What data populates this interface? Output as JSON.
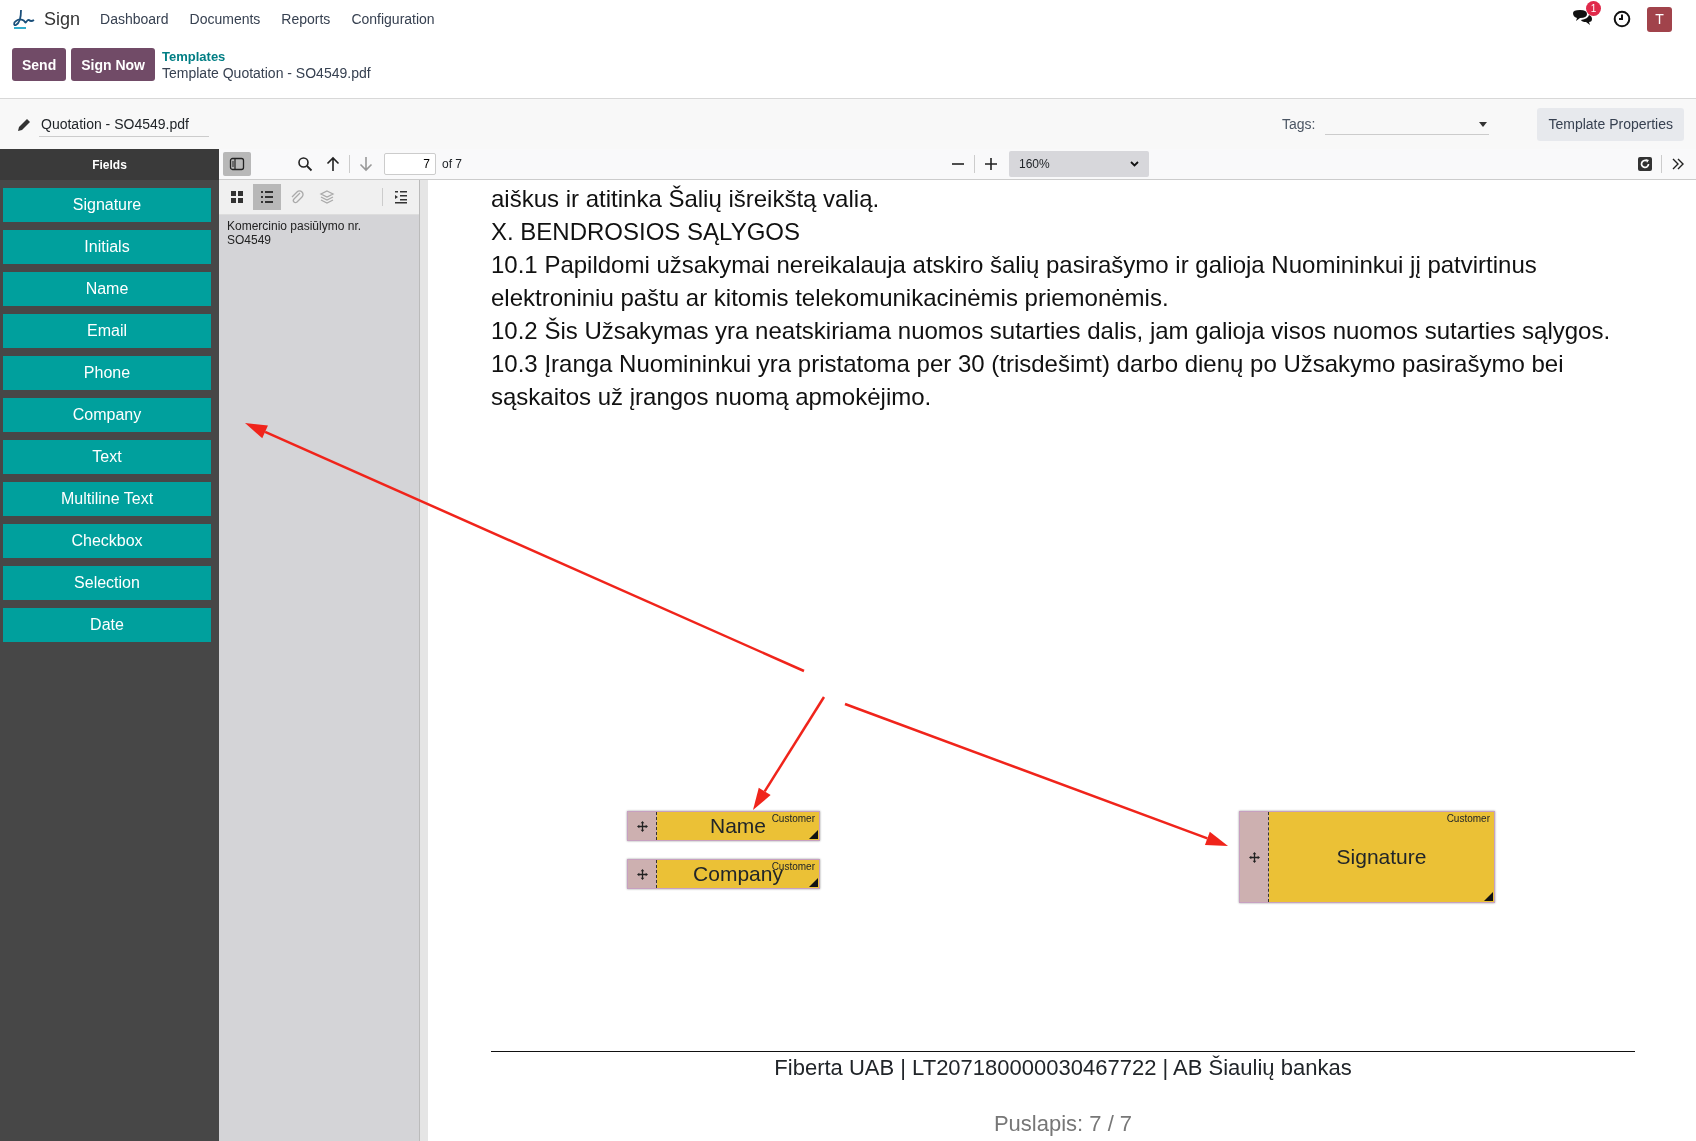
{
  "nav": {
    "app": "Sign",
    "menu": [
      "Dashboard",
      "Documents",
      "Reports",
      "Configuration"
    ],
    "notification_count": "1",
    "avatar": "T"
  },
  "actions": [
    "Send",
    "Sign Now"
  ],
  "breadcrumb": {
    "parent": "Templates",
    "current": "Template Quotation - SO4549.pdf"
  },
  "document_name": "Quotation - SO4549.pdf",
  "tags": {
    "label": "Tags:"
  },
  "template_properties": "Template Properties",
  "fields_panel": {
    "title": "Fields",
    "items": [
      "Signature",
      "Initials",
      "Name",
      "Email",
      "Phone",
      "Company",
      "Text",
      "Multiline Text",
      "Checkbox",
      "Selection",
      "Date"
    ]
  },
  "viewer": {
    "page": "7",
    "page_count": "of 7",
    "zoom": "160%",
    "sidebar_tabs": [
      {
        "kind": "grid",
        "selected": false,
        "disabled": false
      },
      {
        "kind": "list",
        "selected": true,
        "disabled": false
      },
      {
        "kind": "attachment",
        "selected": false,
        "disabled": true
      },
      {
        "kind": "layers",
        "selected": false,
        "disabled": true
      }
    ],
    "outline": [
      "Komercinio pasiūlymo nr. SO4549"
    ]
  },
  "page": {
    "paragraphs": [
      "aiškus ir atitinka Šalių išreikštą valią.",
      "X. BENDROSIOS SĄLYGOS",
      "10.1 Papildomi užsakymai nereikalauja atskiro šalių pasirašymo ir galioja Nuomininkui jį patvirtinus elektroniniu paštu ar kitomis telekomunikacinėmis priemonėmis.",
      "10.2 Šis Užsakymas yra neatskiriama nuomos sutarties dalis, jam galioja visos nuomos sutarties sąlygos.",
      "10.3 Įranga Nuomininkui yra pristatoma per 30 (trisdešimt) darbo dienų po Užsakymo pasirašymo bei sąskaitos už įrangos nuomą apmokėjimo."
    ],
    "fields": [
      {
        "kind": "small",
        "label": "Name",
        "role": "Customer"
      },
      {
        "kind": "small",
        "label": "Company",
        "role": "Customer"
      },
      {
        "kind": "large",
        "label": "Signature",
        "role": "Customer"
      }
    ],
    "footer": "Fiberta UAB | LT207180000030467722 | AB Šiaulių bankas",
    "page_number": "Puslapis: 7 / 7"
  }
}
